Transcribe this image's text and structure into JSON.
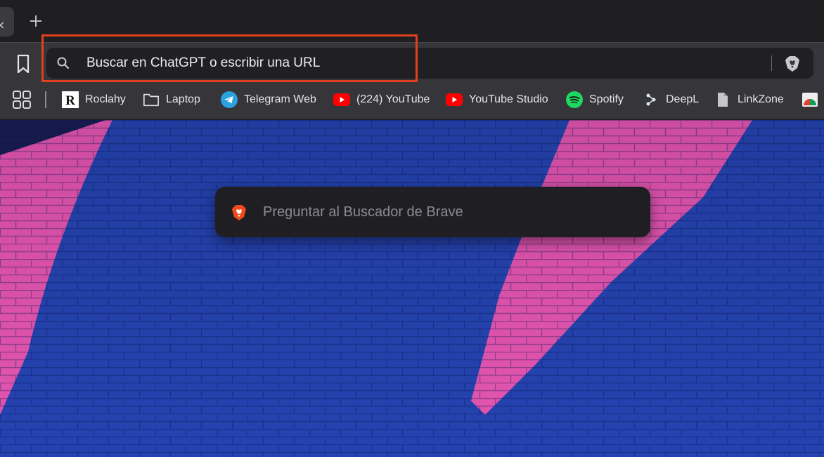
{
  "tabstrip": {
    "close_glyph": "×",
    "new_tab_icon": "plus-icon"
  },
  "toolbar": {
    "bookmark_icon": "bookmark-icon",
    "omnibox": {
      "placeholder": "Buscar en ChatGPT o escribir una URL",
      "search_icon": "search-icon",
      "shields_icon": "brave-shields-icon"
    },
    "highlight_color": "#e0401e"
  },
  "bookmarks": {
    "apps_icon": "apps-grid-icon",
    "items": [
      {
        "label": "Roclahy",
        "icon": "roclahy-r-icon"
      },
      {
        "label": "Laptop",
        "icon": "folder-icon"
      },
      {
        "label": "Telegram Web",
        "icon": "telegram-icon"
      },
      {
        "label": "(224) YouTube",
        "icon": "youtube-icon"
      },
      {
        "label": "YouTube Studio",
        "icon": "youtube-studio-icon"
      },
      {
        "label": "Spotify",
        "icon": "spotify-icon"
      },
      {
        "label": "DeepL",
        "icon": "deepl-icon"
      },
      {
        "label": "LinkZone",
        "icon": "document-icon"
      }
    ]
  },
  "new_tab_page": {
    "search": {
      "placeholder": "Preguntar al Buscador de Brave",
      "icon": "brave-lion-icon"
    },
    "colors": {
      "wall_blue": "#2747b8",
      "wall_pink": "#f05ab8",
      "brave_orange": "#f04a1d"
    }
  }
}
